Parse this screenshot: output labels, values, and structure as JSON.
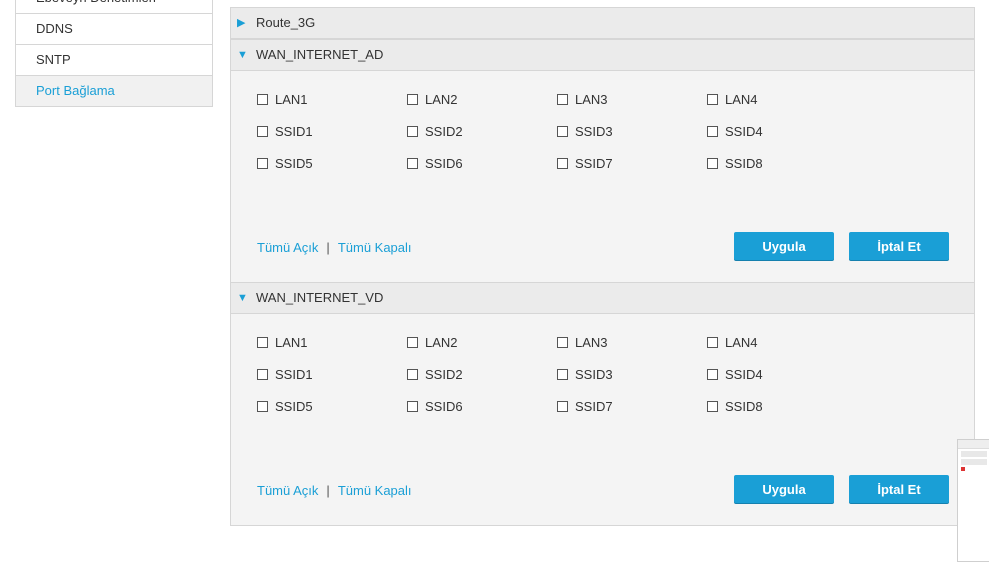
{
  "sidebar": {
    "items": [
      {
        "label": "Ebeveyn Denetimleri",
        "active": false
      },
      {
        "label": "DDNS",
        "active": false
      },
      {
        "label": "SNTP",
        "active": false
      },
      {
        "label": "Port Bağlama",
        "active": true
      }
    ]
  },
  "route3g": {
    "title": "Route_3G",
    "caret": "▶"
  },
  "sections": [
    {
      "title": "WAN_INTERNET_AD",
      "caret": "▼",
      "rows": [
        [
          "LAN1",
          "LAN2",
          "LAN3",
          "LAN4"
        ],
        [
          "SSID1",
          "SSID2",
          "SSID3",
          "SSID4"
        ],
        [
          "SSID5",
          "SSID6",
          "SSID7",
          "SSID8"
        ]
      ],
      "select_all": "Tümü Açık",
      "separator": "|",
      "deselect_all": "Tümü Kapalı",
      "apply": "Uygula",
      "cancel": "İptal Et"
    },
    {
      "title": "WAN_INTERNET_VD",
      "caret": "▼",
      "rows": [
        [
          "LAN1",
          "LAN2",
          "LAN3",
          "LAN4"
        ],
        [
          "SSID1",
          "SSID2",
          "SSID3",
          "SSID4"
        ],
        [
          "SSID5",
          "SSID6",
          "SSID7",
          "SSID8"
        ]
      ],
      "select_all": "Tümü Açık",
      "separator": "|",
      "deselect_all": "Tümü Kapalı",
      "apply": "Uygula",
      "cancel": "İptal Et"
    }
  ],
  "colors": {
    "accent": "#1a9fd6",
    "panel": "#f4f4f4",
    "header": "#ebebeb"
  }
}
